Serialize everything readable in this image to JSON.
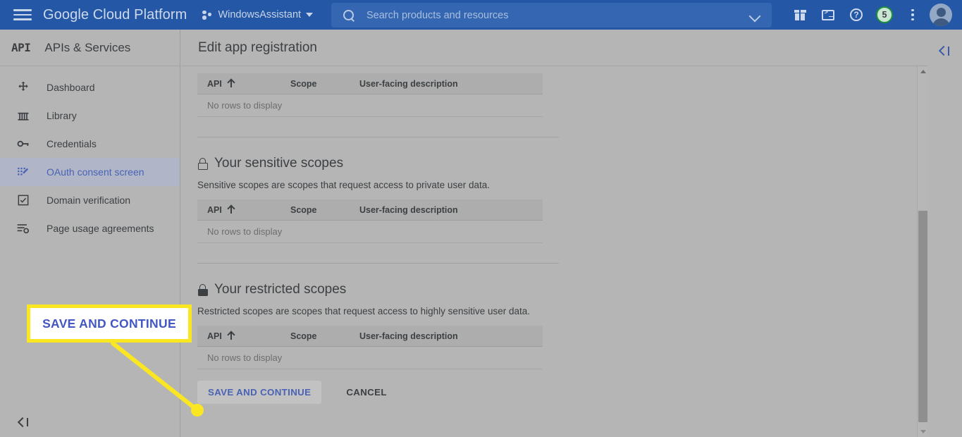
{
  "topbar": {
    "menu_icon": "hamburger-menu-icon",
    "brand": "Google Cloud Platform",
    "project_name": "WindowsAssistant",
    "project_icon": "project-dots-icon",
    "project_caret": "chevron-down-icon",
    "search": {
      "placeholder": "Search products and resources",
      "icon": "search-icon",
      "chevron": "chevron-down-icon"
    },
    "icons": [
      {
        "name": "gift-icon",
        "label": "Offers"
      },
      {
        "name": "cloud-shell-icon",
        "label": "Activate Cloud Shell"
      },
      {
        "name": "help-icon",
        "label": "?"
      },
      {
        "name": "notifications-badge",
        "label": "5"
      },
      {
        "name": "more-options-icon",
        "label": "More"
      },
      {
        "name": "account-avatar",
        "label": "Account"
      }
    ],
    "help_glyph": "?",
    "notification_count": "5",
    "colors": {
      "bar": "#2457a5",
      "search_field": "#3566b1",
      "badge_ring": "#1e8e3e"
    }
  },
  "sidebar": {
    "logo_text": "API",
    "title": "APIs & Services",
    "items": [
      {
        "label": "Dashboard",
        "icon": "dashboard-icon",
        "active": false
      },
      {
        "label": "Library",
        "icon": "library-icon",
        "active": false
      },
      {
        "label": "Credentials",
        "icon": "key-icon",
        "active": false
      },
      {
        "label": "OAuth consent screen",
        "icon": "consent-screen-icon",
        "active": true
      },
      {
        "label": "Domain verification",
        "icon": "checkbox-icon",
        "active": false
      },
      {
        "label": "Page usage agreements",
        "icon": "agreements-icon",
        "active": false
      }
    ],
    "collapse_icon": "collapse-panel-icon"
  },
  "main": {
    "page_title": "Edit app registration",
    "table_columns": {
      "api": "API",
      "scope": "Scope",
      "description": "User-facing description"
    },
    "empty_row_text": "No rows to display",
    "sort_icon": "sort-ascending-arrow-icon",
    "sections": [
      {
        "id": "non-sensitive-scopes",
        "title": "",
        "description": "",
        "has_lock": false,
        "empty": "No rows to display"
      },
      {
        "id": "sensitive-scopes",
        "title": "Your sensitive scopes",
        "description": "Sensitive scopes are scopes that request access to private user data.",
        "has_lock": true,
        "lock_icon": "lock-open-icon",
        "empty": "No rows to display"
      },
      {
        "id": "restricted-scopes",
        "title": "Your restricted scopes",
        "description": "Restricted scopes are scopes that request access to highly sensitive user data.",
        "has_lock": true,
        "lock_icon": "lock-closed-icon",
        "empty": "No rows to display"
      }
    ],
    "buttons": {
      "save": "SAVE AND CONTINUE",
      "cancel": "CANCEL"
    }
  },
  "right_rail": {
    "toggle_icon": "expand-panel-icon"
  },
  "scrollbar": {
    "up_arrow": "scroll-up-arrow-icon",
    "down_arrow": "scroll-down-arrow-icon"
  },
  "annotation": {
    "callout_text": "SAVE AND CONTINUE",
    "callout_border_color": "#fbe721",
    "callout_text_color": "#4256c4",
    "pointer_color": "#fbe721"
  }
}
